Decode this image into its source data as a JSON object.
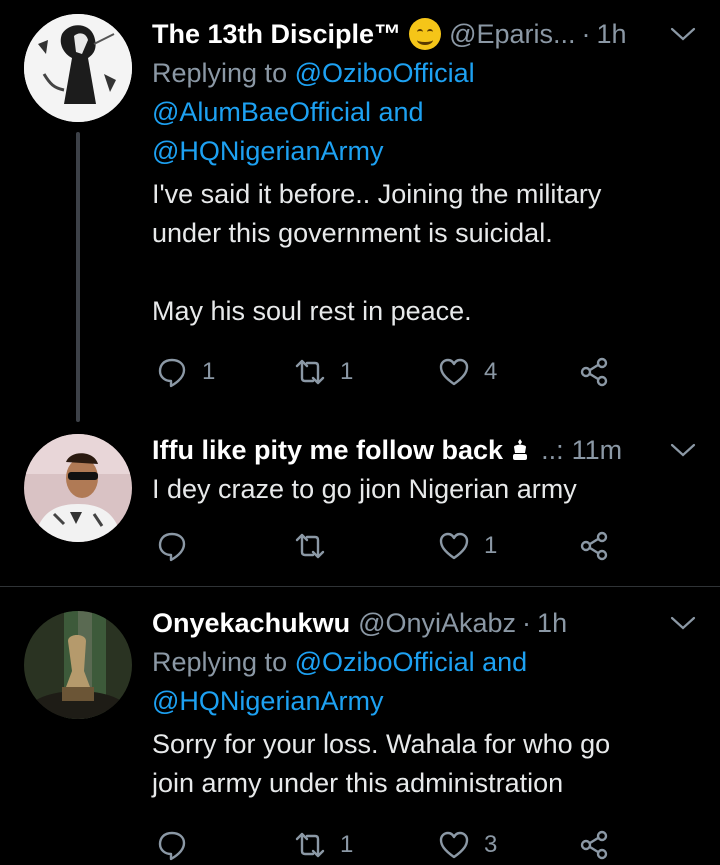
{
  "tweets": [
    {
      "name": "The 13th Disciple™",
      "handle": "@Eparis...",
      "time": "1h",
      "replying_prefix": "Replying to",
      "replying_line1": "@OziboOfficial",
      "replying_line2_link": "@AlumBaeOfficial",
      "replying_line2_and": " and",
      "replying_line3": "@HQNigerianArmy",
      "text_line1": "I've said it before.. Joining the military",
      "text_line2": "under this government is suicidal.",
      "text_line3": "May his soul rest in peace.",
      "reply_count": "1",
      "retweet_count": "1",
      "like_count": "4"
    },
    {
      "name": "Iffu like pity me follow back",
      "handle_trail": "..:",
      "time": "11m",
      "text_line1": "I dey craze to go jion Nigerian army",
      "reply_count": "",
      "retweet_count": "",
      "like_count": "1"
    },
    {
      "name": "Onyekachukwu",
      "handle": "@OnyiAkabz",
      "time": "1h",
      "replying_prefix": "Replying to",
      "replying_line1_link": "@OziboOfficial",
      "replying_line1_and": " and",
      "replying_line2": "@HQNigerianArmy",
      "text_line1": "Sorry for your loss. Wahala for who go",
      "text_line2": "join army under this administration",
      "reply_count": "",
      "retweet_count": "1",
      "like_count": "3"
    }
  ],
  "icons": {
    "reply": "reply-icon",
    "retweet": "retweet-icon",
    "like": "heart-icon",
    "share": "share-icon",
    "more": "chevron-down-icon"
  },
  "colors": {
    "background": "#000000",
    "link": "#1da1f2",
    "muted": "#8b98a5",
    "text": "#e7e9ea"
  }
}
